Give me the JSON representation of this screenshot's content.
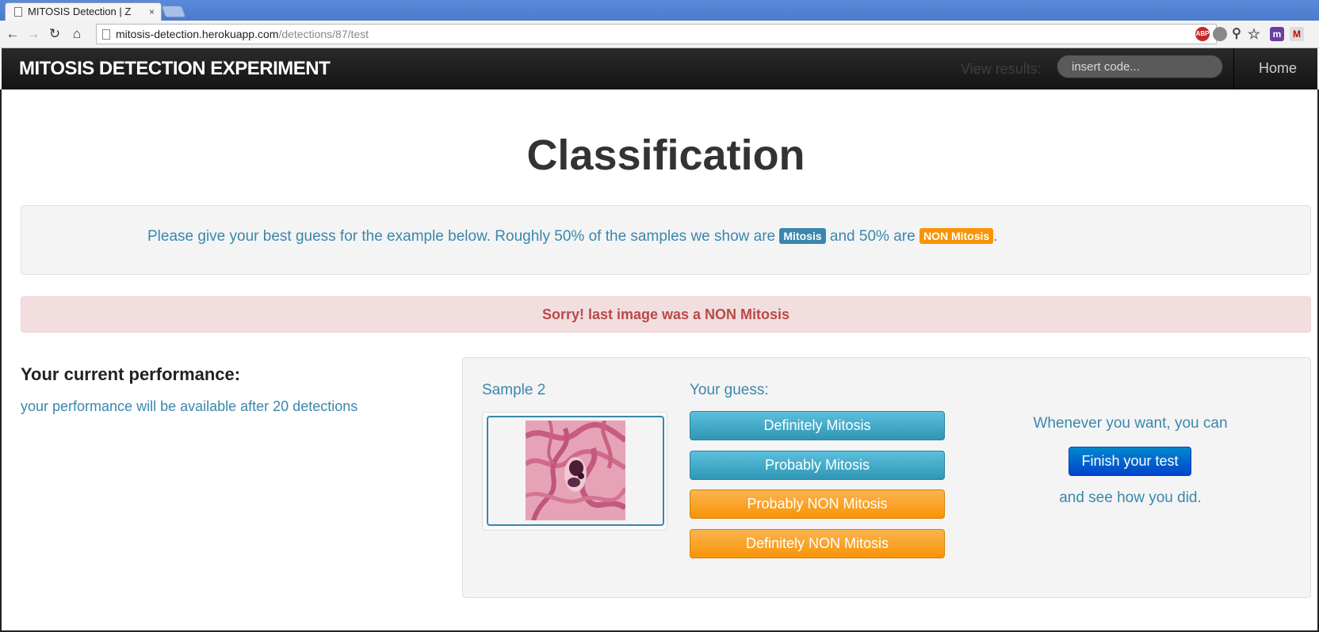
{
  "browser": {
    "tab_title": "MITOSIS Detection | Z",
    "tab_close": "×",
    "url_host": "mitosis-detection.herokuapp.com",
    "url_path": "/detections/87/test",
    "icons": [
      "back-icon",
      "forward-icon",
      "reload-icon",
      "home-icon",
      "adblock-icon",
      "bulb-icon",
      "zoom-icon",
      "star-icon",
      "extension-m-icon",
      "gmail-icon"
    ]
  },
  "navbar": {
    "brand": "MITOSIS DETECTION EXPERIMENT",
    "view_results_label": "View results:",
    "code_placeholder": "insert code...",
    "home_link": "Home"
  },
  "page": {
    "title": "Classification",
    "instructions": {
      "part1": "Please give your best guess for the example below. Roughly 50% of the samples we show are ",
      "mitosis_badge": "Mitosis",
      "part2": " and 50% are ",
      "non_mitosis_badge": "NON Mitosis",
      "part3": "."
    },
    "alert": "Sorry! last image was a NON Mitosis",
    "performance": {
      "title": "Your current performance:",
      "text": "your performance will be available after 20 detections"
    },
    "sample": {
      "label": "Sample 2"
    },
    "guess": {
      "label": "Your guess:",
      "buttons": [
        "Definitely Mitosis",
        "Probably Mitosis",
        "Probably NON Mitosis",
        "Definitely NON Mitosis"
      ]
    },
    "finish": {
      "text_before": "Whenever you want, you can",
      "button": "Finish your test",
      "text_after": "and see how you did."
    }
  },
  "colors": {
    "info": "#3a87ad",
    "warning": "#f89406",
    "danger_text": "#b94a48",
    "primary": "#0044cc"
  }
}
